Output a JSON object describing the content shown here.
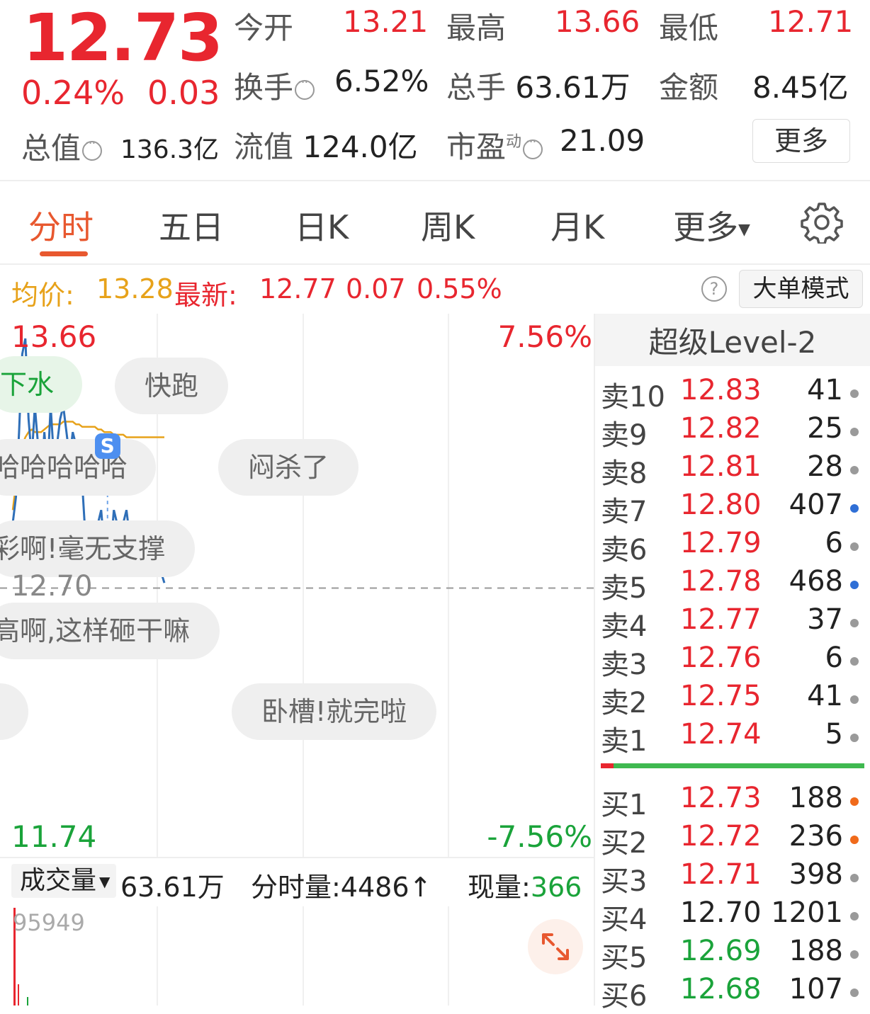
{
  "header": {
    "price": "12.73",
    "change_pct": "0.24%",
    "change_amt": "0.03",
    "open_label": "今开",
    "open_value": "13.21",
    "high_label": "最高",
    "high_value": "13.66",
    "low_label": "最低",
    "low_value": "12.71",
    "turnover_label": "换手",
    "turnover_value": "6.52%",
    "volume_label": "总手",
    "volume_value": "63.61万",
    "amount_label": "金额",
    "amount_value": "8.45亿",
    "mktcap_label": "总值",
    "mktcap_value": "136.3亿",
    "float_label": "流值",
    "float_value": "124.0亿",
    "pe_label": "市盈",
    "pe_sup": "动",
    "pe_value": "21.09",
    "more_label": "更多"
  },
  "tabs": [
    "分时",
    "五日",
    "日K",
    "周K",
    "月K",
    "更多"
  ],
  "info_bar": {
    "avg_label": "均价:",
    "avg_value": "13.28",
    "latest_label": "最新:",
    "latest_value": "12.77",
    "latest_change": "0.07",
    "latest_pct": "0.55%",
    "help": "?",
    "big_order_label": "大单模式"
  },
  "chart_data": {
    "type": "line",
    "y_max_label": "13.66",
    "y_min_label": "11.74",
    "pct_max_label": "7.56%",
    "pct_min_label": "-7.56%",
    "ref_price_label": "12.70",
    "ylim": [
      11.74,
      13.66
    ],
    "ref_price": 12.7,
    "marker_label": "S",
    "series": [
      {
        "values": [
          12.95,
          13.05,
          13.3,
          13.6,
          13.66,
          13.35,
          13.2,
          13.4,
          13.25,
          13.1,
          13.3,
          13.15,
          13.4,
          13.2,
          13.25,
          13.35,
          13.4,
          13.3,
          13.2,
          13.3,
          13.25,
          13.2,
          13.1,
          12.9,
          12.95,
          12.9,
          12.8,
          12.95,
          13.0,
          12.85,
          12.9,
          12.85,
          13.0,
          12.95,
          12.85,
          12.95,
          13.0,
          12.9,
          12.95,
          12.95,
          12.92,
          12.9,
          12.88,
          12.85,
          12.88,
          12.85,
          12.8,
          12.76,
          12.72
        ]
      },
      {
        "values": [
          13.0,
          13.1,
          13.2,
          13.25,
          13.28,
          13.3,
          13.31,
          13.3,
          13.3,
          13.3,
          13.31,
          13.32,
          13.33,
          13.33,
          13.33,
          13.33,
          13.34,
          13.34,
          13.34,
          13.34,
          13.33,
          13.33,
          13.32,
          13.32,
          13.32,
          13.32,
          13.32,
          13.31,
          13.31,
          13.3,
          13.3,
          13.3,
          13.29,
          13.29,
          13.29,
          13.29,
          13.28,
          13.28,
          13.28,
          13.28,
          13.28,
          13.28,
          13.28,
          13.28,
          13.28,
          13.28,
          13.28,
          13.28,
          13.28
        ]
      }
    ]
  },
  "bubbles": [
    "下水",
    "快跑",
    "哈哈哈哈哈",
    "闷杀了",
    "彩啊!毫无支撑",
    "高啊,这样砸干嘛",
    "",
    "卧槽!就完啦"
  ],
  "volume": {
    "selector_label": "成交量",
    "total": "63.61万",
    "tick_vol": "分时量:4486↑",
    "current_label": "现量:",
    "current_value": "366",
    "max_label": "95949"
  },
  "order_book": {
    "title": "超级Level-2",
    "asks": [
      {
        "label": "卖10",
        "price": "12.83",
        "vol": "41",
        "dot": "#9a9a9a"
      },
      {
        "label": "卖9",
        "price": "12.82",
        "vol": "25",
        "dot": "#9a9a9a"
      },
      {
        "label": "卖8",
        "price": "12.81",
        "vol": "28",
        "dot": "#9a9a9a"
      },
      {
        "label": "卖7",
        "price": "12.80",
        "vol": "407",
        "dot": "#2f6fd6"
      },
      {
        "label": "卖6",
        "price": "12.79",
        "vol": "6",
        "dot": "#9a9a9a"
      },
      {
        "label": "卖5",
        "price": "12.78",
        "vol": "468",
        "dot": "#2f6fd6"
      },
      {
        "label": "卖4",
        "price": "12.77",
        "vol": "37",
        "dot": "#9a9a9a"
      },
      {
        "label": "卖3",
        "price": "12.76",
        "vol": "6",
        "dot": "#9a9a9a"
      },
      {
        "label": "卖2",
        "price": "12.75",
        "vol": "41",
        "dot": "#9a9a9a"
      },
      {
        "label": "卖1",
        "price": "12.74",
        "vol": "5",
        "dot": "#9a9a9a"
      }
    ],
    "bids": [
      {
        "label": "买1",
        "price": "12.73",
        "vol": "188",
        "dot": "#f06a1a",
        "price_color": "#e8262f"
      },
      {
        "label": "买2",
        "price": "12.72",
        "vol": "236",
        "dot": "#f06a1a",
        "price_color": "#e8262f"
      },
      {
        "label": "买3",
        "price": "12.71",
        "vol": "398",
        "dot": "#9a9a9a",
        "price_color": "#e8262f"
      },
      {
        "label": "买4",
        "price": "12.70",
        "vol": "1201",
        "dot": "#9a9a9a",
        "price_color": "#222222"
      },
      {
        "label": "买5",
        "price": "12.69",
        "vol": "188",
        "dot": "#9a9a9a",
        "price_color": "#1aa33a"
      },
      {
        "label": "买6",
        "price": "12.68",
        "vol": "107",
        "dot": "#9a9a9a",
        "price_color": "#1aa33a"
      }
    ]
  },
  "colors": {
    "up": "#e8262f",
    "down": "#1aa33a",
    "accent": "#e8582f",
    "avg_line": "#e7a21a",
    "price_line": "#2f6fb8"
  }
}
